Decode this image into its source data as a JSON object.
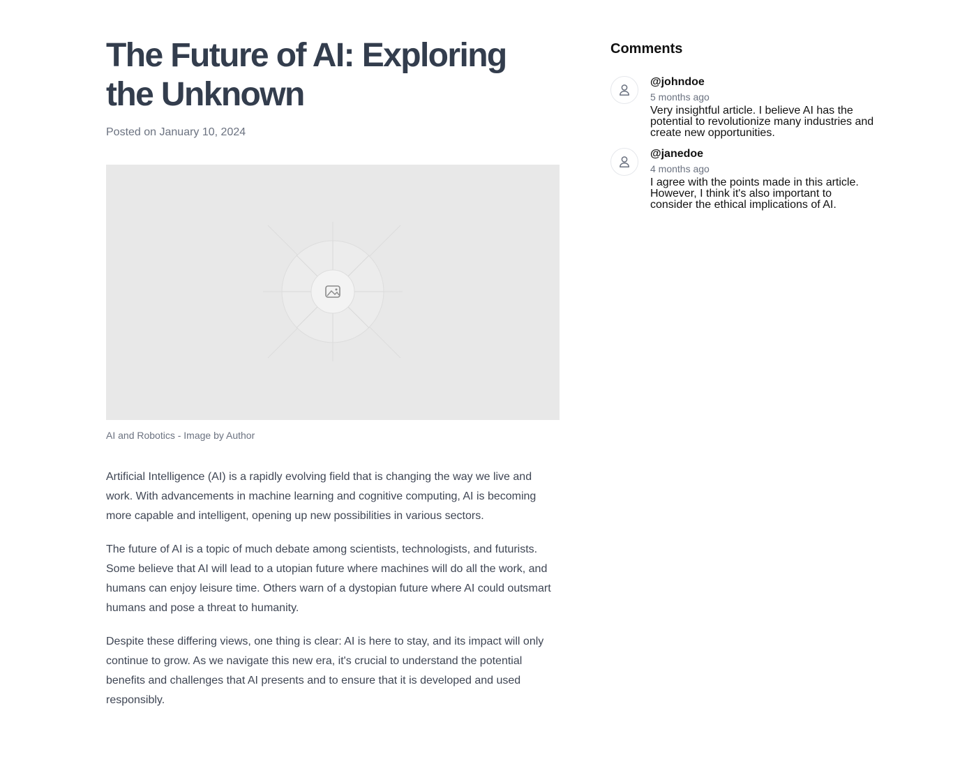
{
  "article": {
    "title": "The Future of AI: Exploring the Unknown",
    "posted": "Posted on January 10, 2024",
    "image_caption": "AI and Robotics - Image by Author",
    "paragraphs": [
      "Artificial Intelligence (AI) is a rapidly evolving field that is changing the way we live and work. With advancements in machine learning and cognitive computing, AI is becoming more capable and intelligent, opening up new possibilities in various sectors.",
      "The future of AI is a topic of much debate among scientists, technologists, and futurists. Some believe that AI will lead to a utopian future where machines will do all the work, and humans can enjoy leisure time. Others warn of a dystopian future where AI could outsmart humans and pose a threat to humanity.",
      "Despite these differing views, one thing is clear: AI is here to stay, and its impact will only continue to grow. As we navigate this new era, it's crucial to understand the potential benefits and challenges that AI presents and to ensure that it is developed and used responsibly."
    ]
  },
  "comments": {
    "title": "Comments",
    "items": [
      {
        "user": "@johndoe",
        "time": "5 months ago",
        "text": "Very insightful article. I believe AI has the potential to revolutionize many industries and create new opportunities."
      },
      {
        "user": "@janedoe",
        "time": "4 months ago",
        "text": "I agree with the points made in this article. However, I think it's also important to consider the ethical implications of AI."
      }
    ]
  }
}
